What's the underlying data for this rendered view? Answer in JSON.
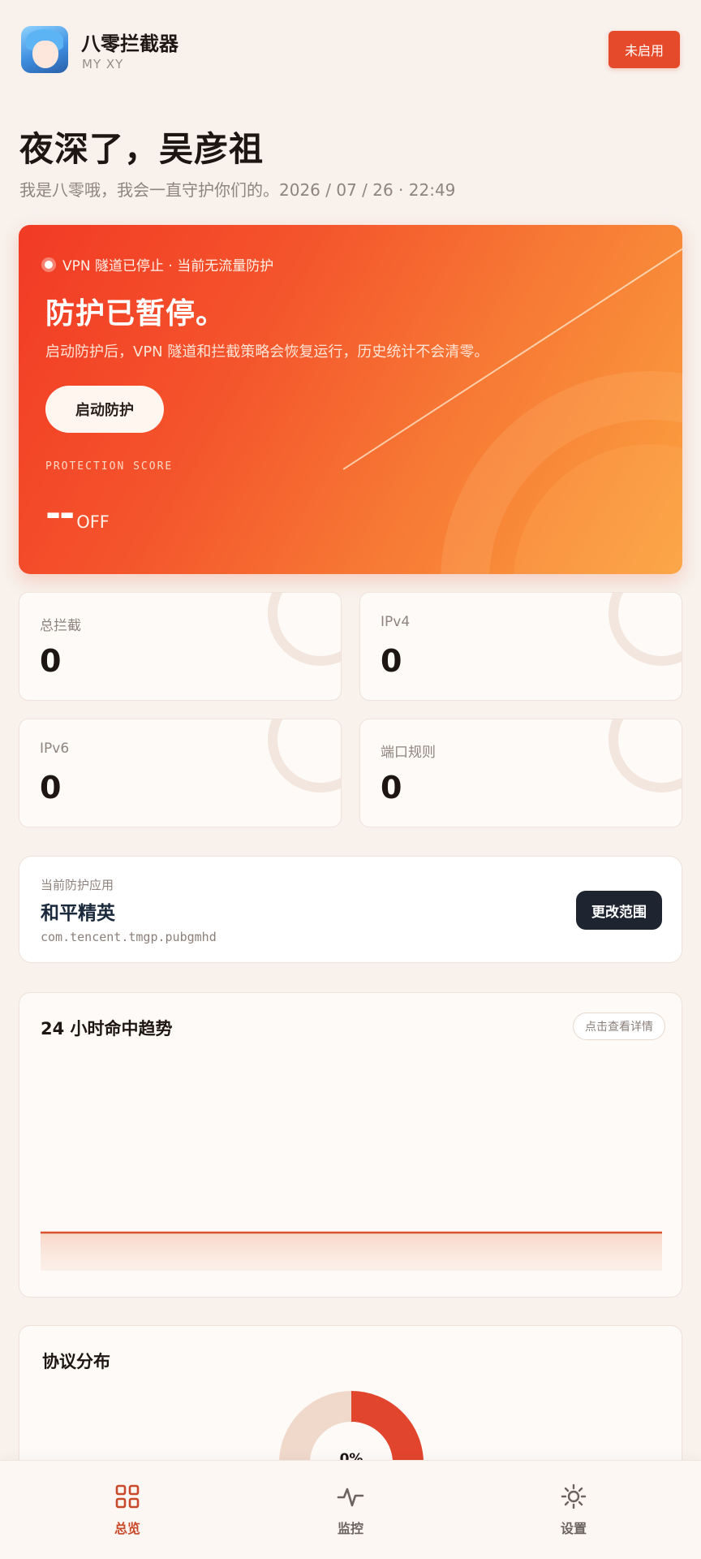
{
  "header": {
    "app_name": "八零拦截器",
    "app_sub": "MY XY",
    "status_button": "未启用"
  },
  "greeting": {
    "title": "夜深了，吴彦祖",
    "subtitle": "我是八零哦，我会一直守护你们的。2026 / 07 / 26 · 22:49"
  },
  "hero": {
    "status": "VPN 隧道已停止 · 当前无流量防护",
    "title": "防护已暂停。",
    "description": "启动防护后，VPN 隧道和拦截策略会恢复运行，历史统计不会清零。",
    "button": "启动防护",
    "score_label": "PROTECTION SCORE",
    "score_value": "--",
    "score_unit": "OFF"
  },
  "stats": [
    {
      "label": "总拦截",
      "value": "0"
    },
    {
      "label": "IPv4",
      "value": "0"
    },
    {
      "label": "IPv6",
      "value": "0"
    },
    {
      "label": "端口规则",
      "value": "0"
    }
  ],
  "protected_app": {
    "heading": "当前防护应用",
    "name": "和平精英",
    "package": "com.tencent.tmgp.pubgmhd",
    "button": "更改范围"
  },
  "trend": {
    "title": "24 小时命中趋势",
    "detail_button": "点击查看详情",
    "line_color": "#d9532f"
  },
  "protocol": {
    "title": "协议分布",
    "center_label": "0%",
    "segments": [
      {
        "color": "#e2452d",
        "fraction": 0.5
      },
      {
        "color": "#f0d8cb",
        "fraction": 0.1
      },
      {
        "color": "#e9a63a",
        "fraction": 0.15
      },
      {
        "color": "#f0d8cb",
        "fraction": 0.25
      }
    ]
  },
  "nav": {
    "items": [
      {
        "label": "总览",
        "icon": "grid-icon",
        "active": true
      },
      {
        "label": "监控",
        "icon": "pulse-icon",
        "active": false
      },
      {
        "label": "设置",
        "icon": "gear-icon",
        "active": false
      }
    ],
    "active_color": "#c94a2a",
    "inactive_color": "#6b6360"
  }
}
